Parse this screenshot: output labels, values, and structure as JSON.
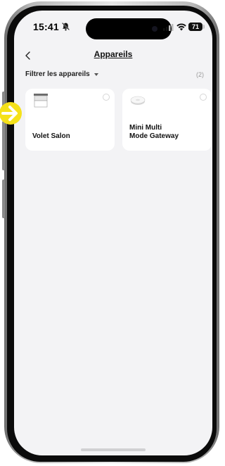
{
  "status_bar": {
    "time": "15:41",
    "battery_percent": "71",
    "battery_level": 0.71,
    "icons": [
      "bell-muted-icon",
      "signal-icon",
      "wifi-icon",
      "battery-icon"
    ]
  },
  "header": {
    "title": "Appareils",
    "back_icon": "chevron-left-icon"
  },
  "filter": {
    "label": "Filtrer les appareils",
    "count": "(2)"
  },
  "devices": [
    {
      "name": "Volet Salon",
      "icon": "shutter-icon"
    },
    {
      "name": "Mini Multi\nMode Gateway",
      "icon": "gateway-icon"
    }
  ],
  "colors": {
    "screen_bg": "#f3f3f5",
    "card_bg": "#ffffff",
    "pointer": "#f5e11a"
  }
}
